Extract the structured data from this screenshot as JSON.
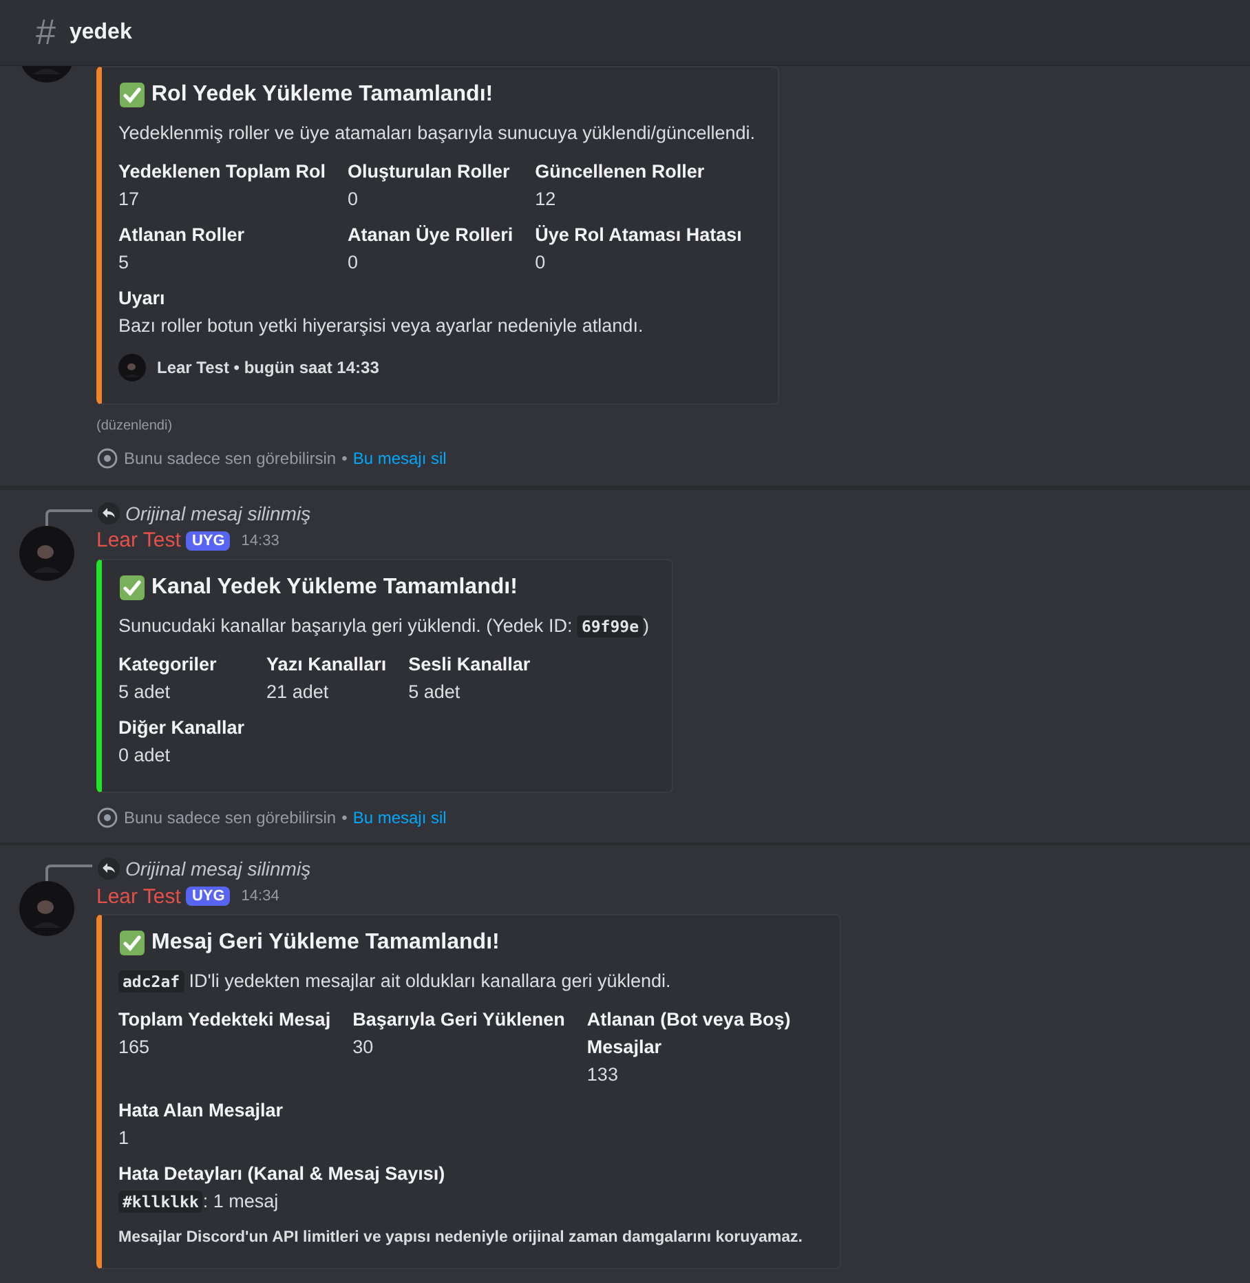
{
  "channel": {
    "hash": "#",
    "name": "yedek"
  },
  "messages": [
    {
      "embed": {
        "color": "#f0832b",
        "title": "Rol Yedek Yükleme Tamamlandı!",
        "description": [
          {
            "kind": "text",
            "text": "Yedeklenmiş roller ve üye atamaları başarıyla sunucuya yüklendi/güncellendi."
          }
        ],
        "fields": [
          {
            "name": "Yedeklenen Toplam Rol",
            "value": [
              {
                "kind": "text",
                "text": "17"
              }
            ],
            "inline": true
          },
          {
            "name": "Oluşturulan Roller",
            "value": [
              {
                "kind": "text",
                "text": "0"
              }
            ],
            "inline": true
          },
          {
            "name": "Güncellenen Roller",
            "value": [
              {
                "kind": "text",
                "text": "12"
              }
            ],
            "inline": true
          },
          {
            "name": "Atlanan Roller",
            "value": [
              {
                "kind": "text",
                "text": "5"
              }
            ],
            "inline": true
          },
          {
            "name": "Atanan Üye Rolleri",
            "value": [
              {
                "kind": "text",
                "text": "0"
              }
            ],
            "inline": true
          },
          {
            "name": "Üye Rol Ataması Hatası",
            "value": [
              {
                "kind": "text",
                "text": "0"
              }
            ],
            "inline": true
          },
          {
            "name": "Uyarı",
            "value": [
              {
                "kind": "text",
                "text": "Bazı roller botun yetki hiyerarşisi veya ayarlar nedeniyle atlandı."
              }
            ],
            "inline": false
          }
        ],
        "footer": {
          "avatar": true,
          "text": "Lear Test • bugün saat 14:33"
        }
      },
      "edited": "(düzenlendi)",
      "ephemeral": {
        "note": "Bunu sadece sen görebilirsin",
        "dot": "•",
        "link": "Bu mesajı sil"
      }
    },
    {
      "reply": "Orijinal mesaj silinmiş",
      "author": {
        "name": "Lear Test",
        "badge": "UYG",
        "time": "14:33"
      },
      "embed": {
        "color": "#22e32a",
        "title": "Kanal Yedek Yükleme Tamamlandı!",
        "description": [
          {
            "kind": "text",
            "text": "Sunucudaki kanallar başarıyla geri yüklendi. (Yedek ID: "
          },
          {
            "kind": "code",
            "text": "69f99e"
          },
          {
            "kind": "text",
            "text": ")"
          }
        ],
        "fields": [
          {
            "name": "Kategoriler",
            "value": [
              {
                "kind": "text",
                "text": "5 adet"
              }
            ],
            "inline": true
          },
          {
            "name": "Yazı Kanalları",
            "value": [
              {
                "kind": "text",
                "text": "21 adet"
              }
            ],
            "inline": true
          },
          {
            "name": "Sesli Kanallar",
            "value": [
              {
                "kind": "text",
                "text": "5 adet"
              }
            ],
            "inline": true
          },
          {
            "name": "Diğer Kanallar",
            "value": [
              {
                "kind": "text",
                "text": "0 adet"
              }
            ],
            "inline": true
          }
        ]
      },
      "ephemeral": {
        "note": "Bunu sadece sen görebilirsin",
        "dot": "•",
        "link": "Bu mesajı sil"
      }
    },
    {
      "reply": "Orijinal mesaj silinmiş",
      "author": {
        "name": "Lear Test",
        "badge": "UYG",
        "time": "14:34"
      },
      "embed": {
        "color": "#f0832b",
        "title": "Mesaj Geri Yükleme Tamamlandı!",
        "description": [
          {
            "kind": "code",
            "text": "adc2af"
          },
          {
            "kind": "text",
            "text": " ID'li yedekten mesajlar ait oldukları kanallara geri yüklendi."
          }
        ],
        "fields": [
          {
            "name": "Toplam Yedekteki Mesaj",
            "value": [
              {
                "kind": "text",
                "text": "165"
              }
            ],
            "inline": true
          },
          {
            "name": "Başarıyla Geri Yüklenen",
            "value": [
              {
                "kind": "text",
                "text": "30"
              }
            ],
            "inline": true
          },
          {
            "name": "Atlanan (Bot veya Boş) Mesajlar",
            "value": [
              {
                "kind": "text",
                "text": "133"
              }
            ],
            "inline": true
          },
          {
            "name": "Hata Alan Mesajlar",
            "value": [
              {
                "kind": "text",
                "text": "1"
              }
            ],
            "inline": false
          },
          {
            "name": "Hata Detayları (Kanal & Mesaj Sayısı)",
            "value": [
              {
                "kind": "code",
                "text": "#kllklkk"
              },
              {
                "kind": "text",
                "text": ": 1 mesaj"
              }
            ],
            "inline": false
          }
        ],
        "footer": {
          "avatar": false,
          "text": "Mesajlar Discord'un API limitleri ve yapısı nedeniyle orijinal zaman damgalarını koruyamaz."
        }
      }
    }
  ]
}
